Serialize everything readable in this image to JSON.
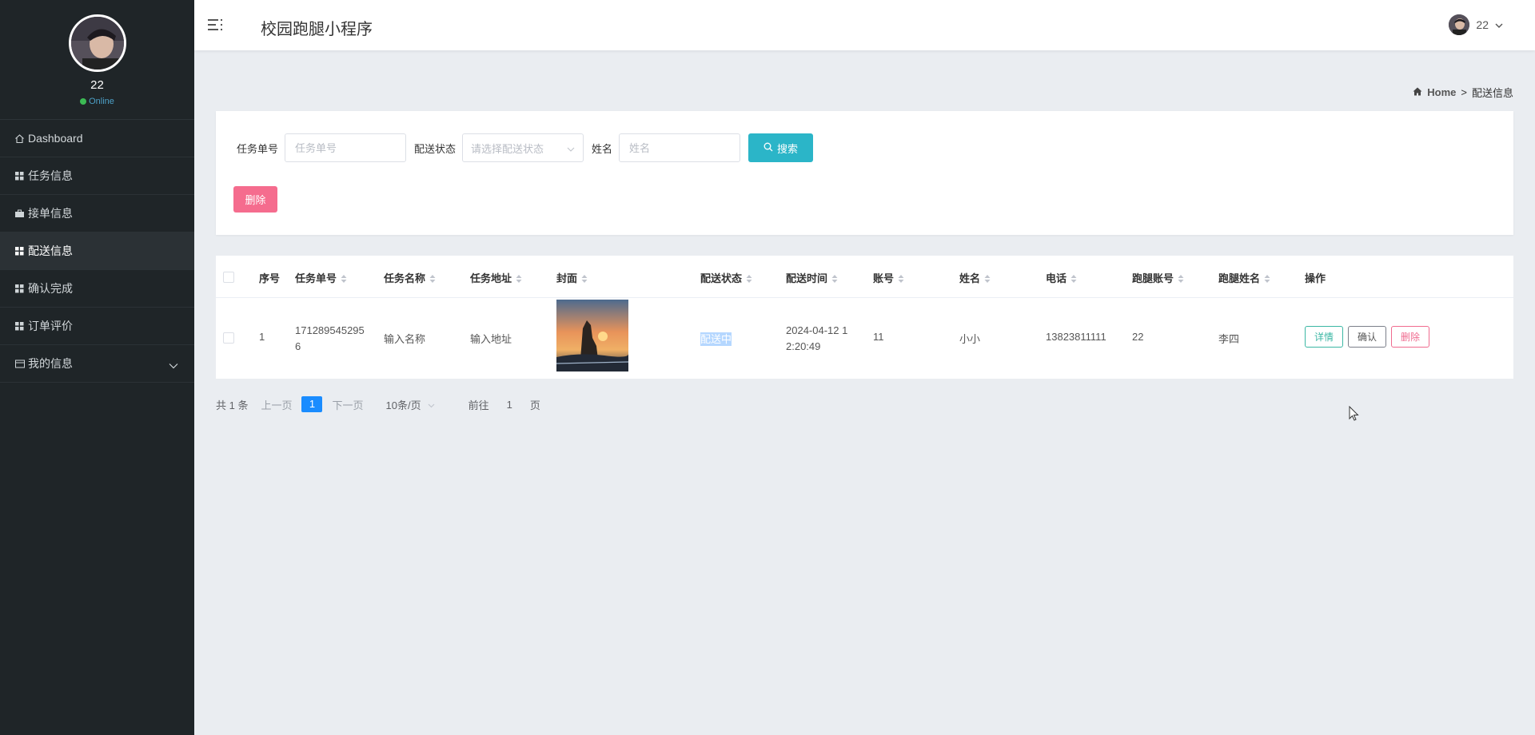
{
  "sidebar": {
    "user_name": "22",
    "status": "Online",
    "items": [
      {
        "label": "Dashboard",
        "icon": "home-icon"
      },
      {
        "label": "任务信息",
        "icon": "grid-icon"
      },
      {
        "label": "接单信息",
        "icon": "grid-icon"
      },
      {
        "label": "配送信息",
        "icon": "grid-icon",
        "active": true
      },
      {
        "label": "确认完成",
        "icon": "grid-icon"
      },
      {
        "label": "订单评价",
        "icon": "grid-icon"
      },
      {
        "label": "我的信息",
        "icon": "card-icon",
        "expandable": true
      }
    ]
  },
  "header": {
    "title": "校园跑腿小程序",
    "user": "22"
  },
  "breadcrumb": {
    "home": "Home",
    "separator": ">",
    "current": "配送信息"
  },
  "search": {
    "task_no_label": "任务单号",
    "task_no_placeholder": "任务单号",
    "status_label": "配送状态",
    "status_placeholder": "请选择配送状态",
    "name_label": "姓名",
    "name_placeholder": "姓名",
    "search_button": "搜索",
    "delete_button": "删除"
  },
  "table": {
    "columns": [
      "序号",
      "任务单号",
      "任务名称",
      "任务地址",
      "封面",
      "配送状态",
      "配送时间",
      "账号",
      "姓名",
      "电话",
      "跑腿账号",
      "跑腿姓名",
      "操作"
    ],
    "rows": [
      {
        "index": "1",
        "task_no_line1": "171289545295",
        "task_no_line2": "6",
        "task_name": "输入名称",
        "task_address": "输入地址",
        "status": "配送中",
        "time_line1": "2024-04-12 1",
        "time_line2": "2:20:49",
        "account": "11",
        "name": "小小",
        "phone": "13823811111",
        "runner_account": "22",
        "runner_name": "李四",
        "actions": {
          "detail": "详情",
          "confirm": "确认",
          "delete": "删除"
        }
      }
    ]
  },
  "pagination": {
    "total": "共 1 条",
    "prev": "上一页",
    "current_page": "1",
    "next": "下一页",
    "page_size": "10条/页",
    "goto_label": "前往",
    "goto_value": "1",
    "goto_suffix": "页"
  }
}
